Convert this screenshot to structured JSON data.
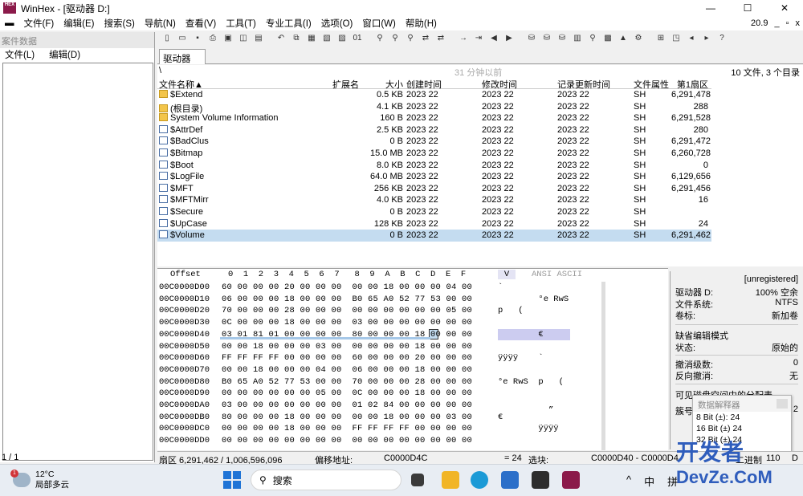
{
  "window": {
    "title": "WinHex - [驱动器 D:]",
    "controls": [
      "—",
      "☐",
      "✕"
    ]
  },
  "menubar": {
    "items": [
      "文件(F)",
      "编辑(E)",
      "搜索(S)",
      "导航(N)",
      "查看(V)",
      "工具(T)",
      "专业工具(I)",
      "选项(O)",
      "窗口(W)",
      "帮助(H)"
    ],
    "version": "20.9",
    "controls": [
      "_",
      "▫",
      "x"
    ]
  },
  "left_panel": {
    "header": "案件数据",
    "menu": [
      "文件(L)",
      "编辑(D)"
    ]
  },
  "tab": {
    "label": "驱动器 D:"
  },
  "pathbar": {
    "path": "\\",
    "time": "31 分钟以前",
    "summary": "10 文件, 3 个目录"
  },
  "filelist": {
    "columns": [
      "文件名称▲",
      "扩展名",
      "大小",
      "创建时间",
      "修改时间",
      "记录更新时间",
      "文件属性",
      "第1扇区"
    ],
    "rows": [
      {
        "name": "$Extend",
        "type": "folder",
        "size": "0.5 KB",
        "created": "2023  22",
        "modified": "2023  22",
        "record": "2023  22",
        "attr": "SH",
        "sector": "6,291,478"
      },
      {
        "name": "(根目录)",
        "type": "folder",
        "size": "4.1 KB",
        "created": "2023  22",
        "modified": "2023  22",
        "record": "2023  22",
        "attr": "SH",
        "sector": "288"
      },
      {
        "name": "System Volume Information",
        "type": "folder",
        "size": "160 B",
        "created": "2023  22",
        "modified": "2023  22",
        "record": "2023  22",
        "attr": "SH",
        "sector": "6,291,528"
      },
      {
        "name": "$AttrDef",
        "type": "file",
        "size": "2.5 KB",
        "created": "2023  22",
        "modified": "2023  22",
        "record": "2023  22",
        "attr": "SH",
        "sector": "280"
      },
      {
        "name": "$BadClus",
        "type": "file",
        "size": "0 B",
        "created": "2023  22",
        "modified": "2023  22",
        "record": "2023  22",
        "attr": "SH",
        "sector": "6,291,472"
      },
      {
        "name": "$Bitmap",
        "type": "file",
        "size": "15.0 MB",
        "created": "2023  22",
        "modified": "2023  22",
        "record": "2023  22",
        "attr": "SH",
        "sector": "6,260,728"
      },
      {
        "name": "$Boot",
        "type": "file",
        "size": "8.0 KB",
        "created": "2023  22",
        "modified": "2023  22",
        "record": "2023  22",
        "attr": "SH",
        "sector": "0"
      },
      {
        "name": "$LogFile",
        "type": "file",
        "size": "64.0 MB",
        "created": "2023  22",
        "modified": "2023  22",
        "record": "2023  22",
        "attr": "SH",
        "sector": "6,129,656"
      },
      {
        "name": "$MFT",
        "type": "file",
        "size": "256 KB",
        "created": "2023  22",
        "modified": "2023  22",
        "record": "2023  22",
        "attr": "SH",
        "sector": "6,291,456"
      },
      {
        "name": "$MFTMirr",
        "type": "file",
        "size": "4.0 KB",
        "created": "2023  22",
        "modified": "2023  22",
        "record": "2023  22",
        "attr": "SH",
        "sector": "16"
      },
      {
        "name": "$Secure",
        "type": "file",
        "size": "0 B",
        "created": "2023  22",
        "modified": "2023  22",
        "record": "2023  22",
        "attr": "SH",
        "sector": ""
      },
      {
        "name": "$UpCase",
        "type": "file",
        "size": "128 KB",
        "created": "2023  22",
        "modified": "2023  22",
        "record": "2023  22",
        "attr": "SH",
        "sector": "24"
      },
      {
        "name": "$Volume",
        "type": "file",
        "size": "0 B",
        "created": "2023  22",
        "modified": "2023  22",
        "record": "2023  22",
        "attr": "SH",
        "sector": "6,291,462",
        "selected": true
      }
    ]
  },
  "hex": {
    "offset_label": "Offset",
    "col_labels": [
      "0",
      "1",
      "2",
      "3",
      "4",
      "5",
      "6",
      "7",
      "8",
      "9",
      "A",
      "B",
      "C",
      "D",
      "E",
      "F"
    ],
    "mode_label": "V",
    "ascii_label": "ANSI ASCII",
    "rows": [
      {
        "offset": "00C0000D00",
        "bytes": "60 00 00 00 20 00 00 00  00 00 18 00 00 00 04 00",
        "ascii": "`"
      },
      {
        "offset": "00C0000D10",
        "bytes": "06 00 00 00 18 00 00 00  B0 65 A0 52 77 53 00 00",
        "ascii": "        °e RwS"
      },
      {
        "offset": "00C0000D20",
        "bytes": "70 00 00 00 28 00 00 00  00 00 00 00 00 00 05 00",
        "ascii": "p   ("
      },
      {
        "offset": "00C0000D30",
        "bytes": "0C 00 00 00 18 00 00 00  03 00 00 00 00 00 00 00",
        "ascii": ""
      },
      {
        "offset": "00C0000D40",
        "bytes": "03 01 81 01 00 00 00 00  80 00 00 00 18 00 00 00",
        "ascii": "        €",
        "selected": true
      },
      {
        "offset": "00C0000D50",
        "bytes": "00 00 18 00 00 00 03 00  00 00 00 00 18 00 00 00",
        "ascii": ""
      },
      {
        "offset": "00C0000D60",
        "bytes": "FF FF FF FF 00 00 00 00  60 00 00 00 20 00 00 00",
        "ascii": "ÿÿÿÿ    `"
      },
      {
        "offset": "00C0000D70",
        "bytes": "00 00 18 00 00 00 04 00  06 00 00 00 18 00 00 00",
        "ascii": ""
      },
      {
        "offset": "00C0000D80",
        "bytes": "B0 65 A0 52 77 53 00 00  70 00 00 00 28 00 00 00",
        "ascii": "°e RwS  p   ("
      },
      {
        "offset": "00C0000D90",
        "bytes": "00 00 00 00 00 00 05 00  0C 00 00 00 18 00 00 00",
        "ascii": ""
      },
      {
        "offset": "00C0000DA0",
        "bytes": "03 00 00 00 00 00 00 00  01 02 84 00 00 00 00 00",
        "ascii": "          „"
      },
      {
        "offset": "00C0000DB0",
        "bytes": "80 00 00 00 18 00 00 00  00 00 18 00 00 00 03 00",
        "ascii": "€"
      },
      {
        "offset": "00C0000DC0",
        "bytes": "00 00 00 00 18 00 00 00  FF FF FF FF 00 00 00 00",
        "ascii": "        ÿÿÿÿ"
      },
      {
        "offset": "00C0000DD0",
        "bytes": "00 00 00 00 00 00 00 00  00 00 00 00 00 00 00 00",
        "ascii": ""
      }
    ]
  },
  "info_panel": {
    "status": "[unregistered]",
    "rows": [
      {
        "k": "驱动器 D:",
        "v": "100% 空余"
      },
      {
        "k": "文件系统:",
        "v": "NTFS"
      },
      {
        "k": "卷标:",
        "v": "新加卷"
      },
      {
        "k": "缺省编辑模式",
        "v": ""
      },
      {
        "k": "状态:",
        "v": "原始的"
      },
      {
        "k": "撤消级数:",
        "v": "0"
      },
      {
        "k": "反向撤消:",
        "v": "无"
      },
      {
        "k": "可见磁盘空间中的分配表",
        "v": ""
      },
      {
        "k": "簇号",
        "v": "2"
      }
    ]
  },
  "interpreter": {
    "title": "数据解释器",
    "lines": [
      "8 Bit (±): 24",
      "16 Bit (±) 24",
      "32 Bit (±) 24"
    ]
  },
  "statusbar": {
    "left": "1 / 1",
    "sector": "扇区 6,291,462 / 1,006,596,096",
    "offset_label": "偏移地址:",
    "offset_value": "C0000D4C",
    "value": "= 24",
    "select_label": "选块:",
    "range": "C0000D40 - C0000D4",
    "binary_label": "二进制",
    "binary_value": "110",
    "drive": "D"
  },
  "taskbar": {
    "weather_temp": "12°C",
    "weather_desc": "局部多云",
    "weather_badge": "1",
    "search_placeholder": "搜索",
    "tray": [
      "^",
      "中",
      "拼"
    ]
  },
  "watermark": {
    "line1": "开发者",
    "line2": "DevZe.CoM"
  }
}
